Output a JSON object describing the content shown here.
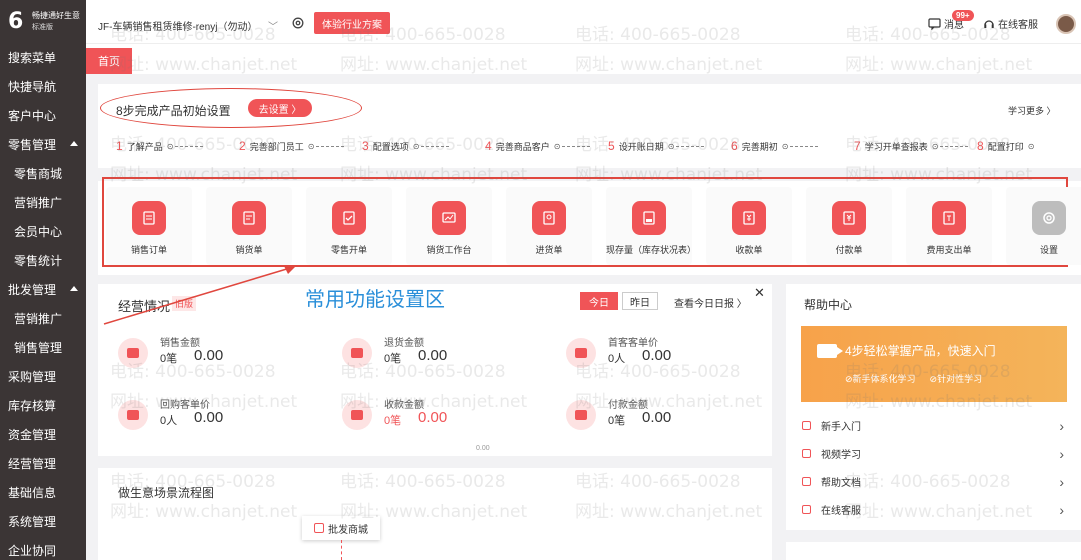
{
  "sidebar": {
    "logo_title": "畅捷通好生意",
    "logo_sub": "标准版",
    "items": [
      {
        "label": "搜索菜单",
        "sub": false,
        "caret": false
      },
      {
        "label": "快捷导航",
        "sub": false,
        "caret": false
      },
      {
        "label": "客户中心",
        "sub": false,
        "caret": false
      },
      {
        "label": "零售管理",
        "sub": false,
        "caret": true
      },
      {
        "label": "零售商城",
        "sub": true,
        "caret": false
      },
      {
        "label": "营销推广",
        "sub": true,
        "caret": false
      },
      {
        "label": "会员中心",
        "sub": true,
        "caret": false
      },
      {
        "label": "零售统计",
        "sub": true,
        "caret": false
      },
      {
        "label": "批发管理",
        "sub": false,
        "caret": true
      },
      {
        "label": "营销推广",
        "sub": true,
        "caret": false
      },
      {
        "label": "销售管理",
        "sub": true,
        "caret": false
      },
      {
        "label": "采购管理",
        "sub": false,
        "caret": false
      },
      {
        "label": "库存核算",
        "sub": false,
        "caret": false
      },
      {
        "label": "资金管理",
        "sub": false,
        "caret": false
      },
      {
        "label": "经营管理",
        "sub": false,
        "caret": false
      },
      {
        "label": "基础信息",
        "sub": false,
        "caret": false
      },
      {
        "label": "系统管理",
        "sub": false,
        "caret": false
      },
      {
        "label": "企业协同",
        "sub": false,
        "caret": false
      }
    ]
  },
  "header": {
    "company": "JF-车辆销售租赁维修-renyj（勿动）",
    "caret": "﹀",
    "trial_label": "体验行业方案",
    "msg_label": "消息",
    "badge": "99+",
    "service_label": "在线客服"
  },
  "tabs": {
    "home": "首页"
  },
  "setup": {
    "title": "8步完成产品初始设置",
    "button": "去设置 〉",
    "learn_more": "学习更多 〉",
    "steps": [
      {
        "num": "1",
        "label": "了解产品"
      },
      {
        "num": "2",
        "label": "完善部门员工"
      },
      {
        "num": "3",
        "label": "配置选项"
      },
      {
        "num": "4",
        "label": "完善商品客户"
      },
      {
        "num": "5",
        "label": "设开账日期"
      },
      {
        "num": "6",
        "label": "完善期初"
      },
      {
        "num": "7",
        "label": "学习开单查报表"
      },
      {
        "num": "8",
        "label": "配置打印"
      }
    ]
  },
  "functions": [
    {
      "label": "销售订单",
      "gray": false
    },
    {
      "label": "销货单",
      "gray": false
    },
    {
      "label": "零售开单",
      "gray": false
    },
    {
      "label": "销货工作台",
      "gray": false
    },
    {
      "label": "进货单",
      "gray": false
    },
    {
      "label": "现存量（库存状况表）",
      "gray": false
    },
    {
      "label": "收款单",
      "gray": false
    },
    {
      "label": "付款单",
      "gray": false
    },
    {
      "label": "费用支出单",
      "gray": false
    },
    {
      "label": "设置",
      "gray": true
    }
  ],
  "annotation": {
    "area_label": "常用功能设置区"
  },
  "business": {
    "title": "经营情况",
    "tag": "旧版",
    "today": "今日",
    "yesterday": "昨日",
    "today_report": "查看今日日报 〉",
    "close": "✕",
    "metrics": [
      {
        "name": "销售金额",
        "count": "0笔",
        "amount": "0.00",
        "red": false
      },
      {
        "name": "退货金额",
        "count": "0笔",
        "amount": "0.00",
        "red": false
      },
      {
        "name": "首客客单价",
        "count": "0人",
        "amount": "0.00",
        "red": false
      },
      {
        "name": "回购客单价",
        "count": "0人",
        "amount": "0.00",
        "red": false
      },
      {
        "name": "收款金额",
        "count": "0笔",
        "amount": "0.00",
        "red": true
      },
      {
        "name": "付款金额",
        "count": "0笔",
        "amount": "0.00",
        "red": false
      }
    ],
    "small": "0.00"
  },
  "flow": {
    "title": "做生意场景流程图",
    "node": "批发商城"
  },
  "help": {
    "title": "帮助中心",
    "banner_main": "4步轻松掌握产品，快速入门",
    "banner_tag1": "⊘新手体系化学习",
    "banner_tag2": "⊘针对性学习",
    "links": [
      "新手入门",
      "视频学习",
      "帮助文档",
      "在线客服"
    ]
  },
  "watermark": {
    "phone": "电话: 400-665-0028",
    "site": "网址: www.chanjet.net"
  },
  "colors": {
    "accent": "#f05457",
    "sidebar": "#3b3535",
    "annotation_blue": "#2a8fd9",
    "annotation_red": "#e0473e"
  }
}
